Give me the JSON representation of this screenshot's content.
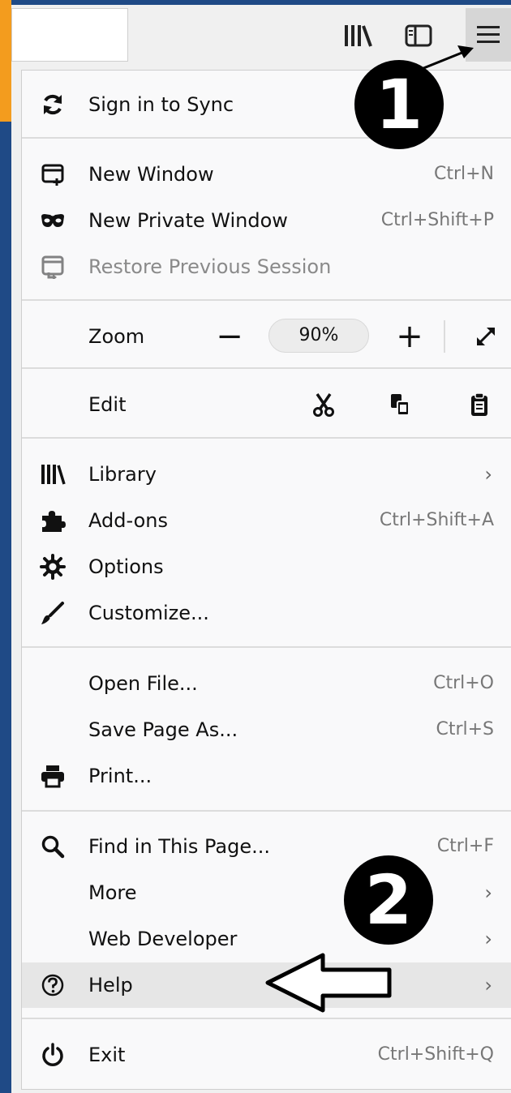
{
  "colors": {
    "accent_orange": "#f39c1e",
    "accent_blue": "#1f4a86",
    "highlight": "#e6e6e6"
  },
  "toolbar": {
    "library_icon": "library-icon",
    "sidebar_icon": "sidebar-icon",
    "menu_icon": "hamburger-menu-icon"
  },
  "menu": {
    "sync": {
      "label": "Sign in to Sync",
      "icon": "sync-icon"
    },
    "new_window": {
      "label": "New Window",
      "shortcut": "Ctrl+N",
      "icon": "new-window-icon"
    },
    "new_private": {
      "label": "New Private Window",
      "shortcut": "Ctrl+Shift+P",
      "icon": "private-mask-icon"
    },
    "restore": {
      "label": "Restore Previous Session",
      "icon": "restore-session-icon"
    },
    "zoom": {
      "label": "Zoom",
      "minus": "−",
      "value": "90%",
      "plus": "+"
    },
    "edit": {
      "label": "Edit"
    },
    "library": {
      "label": "Library",
      "chevron": "›",
      "icon": "library-icon"
    },
    "addons": {
      "label": "Add-ons",
      "shortcut": "Ctrl+Shift+A",
      "icon": "puzzle-icon"
    },
    "options": {
      "label": "Options",
      "icon": "gear-icon"
    },
    "customize": {
      "label": "Customize...",
      "icon": "brush-icon"
    },
    "open_file": {
      "label": "Open File...",
      "shortcut": "Ctrl+O"
    },
    "save_page": {
      "label": "Save Page As...",
      "shortcut": "Ctrl+S"
    },
    "print": {
      "label": "Print...",
      "icon": "printer-icon"
    },
    "find": {
      "label": "Find in This Page...",
      "shortcut": "Ctrl+F",
      "icon": "search-icon"
    },
    "more": {
      "label": "More",
      "chevron": "›"
    },
    "web_developer": {
      "label": "Web Developer",
      "chevron": "›"
    },
    "help": {
      "label": "Help",
      "chevron": "›",
      "icon": "help-circle-icon"
    },
    "exit": {
      "label": "Exit",
      "shortcut": "Ctrl+Shift+Q",
      "icon": "power-icon"
    }
  },
  "annotations": {
    "marker_1": "1",
    "marker_2": "2"
  }
}
